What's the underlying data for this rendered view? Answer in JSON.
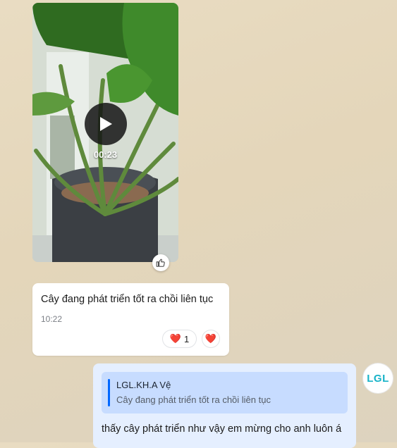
{
  "video": {
    "duration": "00:23",
    "play_icon": "play-icon"
  },
  "like_icon": "thumbs-up-icon",
  "message1": {
    "text": "Cây đang phát triển tốt ra chồi liên tục",
    "time": "10:22",
    "reaction_emoji": "❤️",
    "reaction_count": "1",
    "add_reaction_emoji": "❤️"
  },
  "message2": {
    "quote_author": "LGL.KH.A Vệ",
    "quote_text": "Cây đang phát triển tốt ra chồi liên tục",
    "text": "thấy cây phát triển như vậy em mừng cho anh luôn á"
  },
  "avatar": {
    "initials": "LGL",
    "color": "#17b3c8"
  },
  "colors": {
    "accent": "#0068ff",
    "reply_bubble": "#e5efff",
    "quote_bg": "#c7dcff"
  }
}
